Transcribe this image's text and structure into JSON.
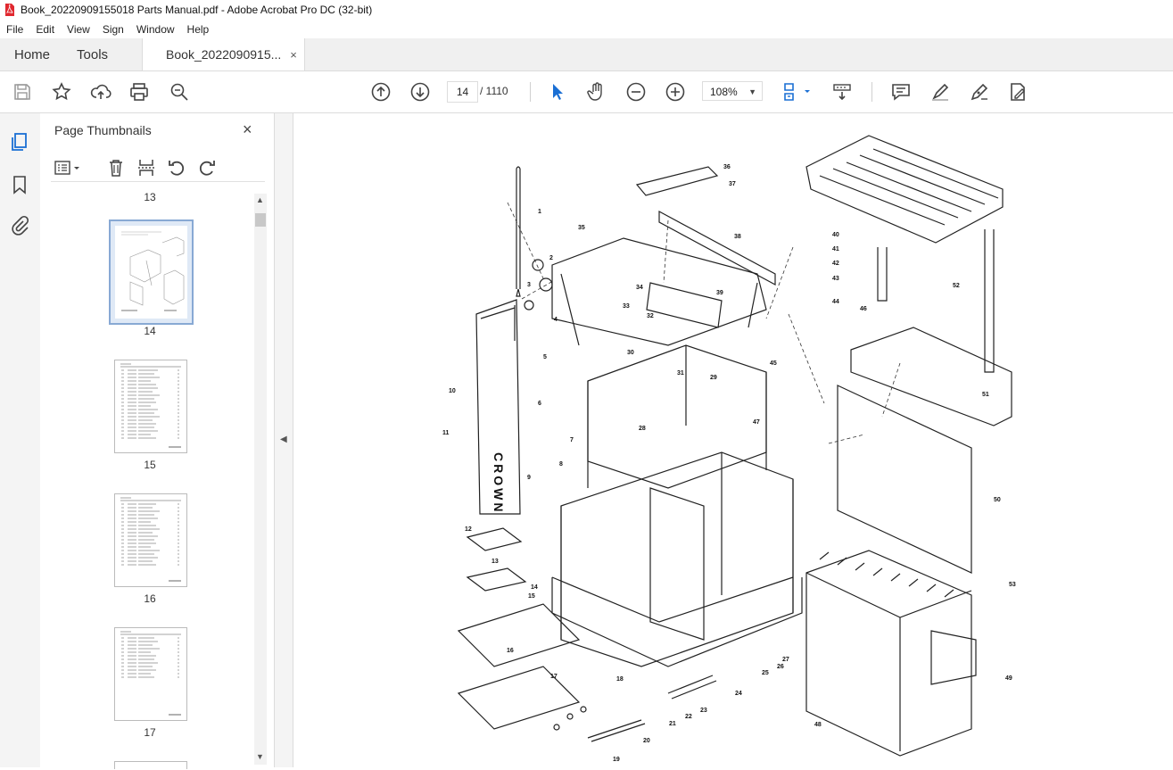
{
  "window": {
    "title": "Book_20220909155018 Parts Manual.pdf - Adobe Acrobat Pro DC (32-bit)"
  },
  "menu": [
    "File",
    "Edit",
    "View",
    "Sign",
    "Window",
    "Help"
  ],
  "tabs": {
    "home": "Home",
    "tools": "Tools",
    "document": "Book_2022090915...",
    "close_glyph": "×"
  },
  "toolbar": {
    "current_page": "14",
    "total_pages": "/ 1110",
    "zoom": "108%"
  },
  "thumbnails": {
    "title": "Page Thumbnails",
    "close_glyph": "×",
    "pages": [
      {
        "label": "13"
      },
      {
        "label": "14",
        "selected": true
      },
      {
        "label": "15"
      },
      {
        "label": "16"
      },
      {
        "label": "17"
      }
    ]
  },
  "diagram": {
    "brand_text": "CROWN",
    "callouts": [
      "1",
      "2",
      "3",
      "4",
      "5",
      "6",
      "7",
      "8",
      "9",
      "10",
      "11",
      "12",
      "13",
      "14",
      "15",
      "16",
      "17",
      "18",
      "19",
      "20",
      "21",
      "22",
      "23",
      "24",
      "25",
      "26",
      "27",
      "28",
      "29",
      "30",
      "31",
      "32",
      "33",
      "34",
      "35",
      "36",
      "37",
      "38",
      "39",
      "40",
      "41",
      "42",
      "43",
      "44",
      "45",
      "46",
      "47",
      "48",
      "49",
      "50",
      "51",
      "52",
      "53"
    ]
  },
  "colors": {
    "accent_blue": "#1a6fd4",
    "acrobat_red": "#e0282f"
  }
}
